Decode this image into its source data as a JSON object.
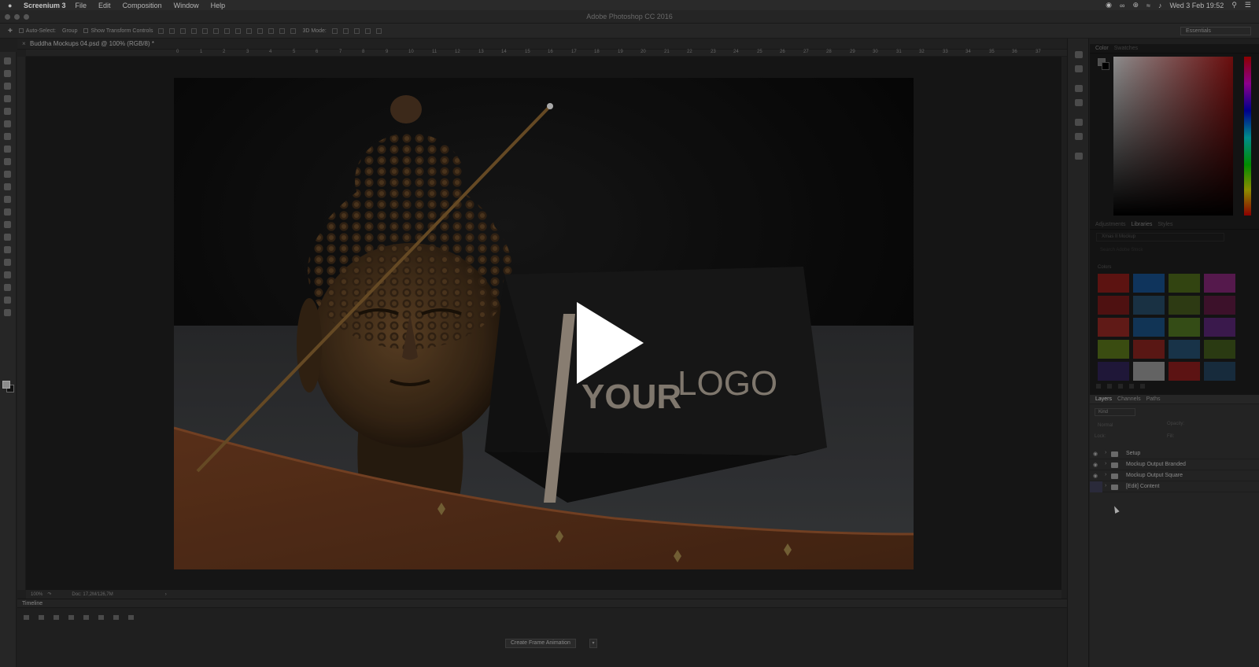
{
  "menubar": {
    "app_name": "Screenium 3",
    "items": [
      "File",
      "Edit",
      "Composition",
      "Window",
      "Help"
    ],
    "datetime": "Wed 3 Feb  19:52"
  },
  "window": {
    "title": "Adobe Photoshop CC 2016"
  },
  "options_bar": {
    "auto_select": "Auto-Select:",
    "group_select": "Group",
    "show_transform": "Show Transform Controls",
    "mode_3d": "3D Mode:",
    "workspace": "Essentials"
  },
  "document": {
    "tab_title": "Buddha Mockups 04.psd @ 100% (RGB/8) *",
    "ruler_numbers": [
      "0",
      "1",
      "2",
      "3",
      "4",
      "5",
      "6",
      "7",
      "8",
      "9",
      "10",
      "11",
      "12",
      "13",
      "14",
      "15",
      "16",
      "17",
      "18",
      "19",
      "20",
      "21",
      "22",
      "23",
      "24",
      "25",
      "26",
      "27",
      "28",
      "29",
      "30",
      "31",
      "32",
      "33",
      "34",
      "35",
      "36",
      "37"
    ],
    "zoom": "100%",
    "doc_info": "Doc: 17,2M/126,7M",
    "photo_logo_bold": "YOUR",
    "photo_logo_light": "LOGO"
  },
  "timeline": {
    "title": "Timeline",
    "create_button": "Create Frame Animation"
  },
  "color_panel": {
    "tabs": [
      "Color",
      "Swatches"
    ]
  },
  "libraries_panel": {
    "tabs": [
      "Adjustments",
      "Libraries",
      "Styles"
    ],
    "library": "Xmas II Mockup",
    "search_placeholder": "Search Adobe Stock",
    "colors_label": "Colors",
    "swatches": [
      "#a8231f",
      "#1d5fa8",
      "#5b7c1f",
      "#9c2f8a",
      "#8e1f1f",
      "#2f5a7a",
      "#526b24",
      "#6e1f4e",
      "#b0302a",
      "#1f5f9c",
      "#5f8a28",
      "#6a2f8a",
      "#6b8a1f",
      "#a32a25",
      "#2c5d83",
      "#4e6a22",
      "#3a2a66",
      "#b5b5b5",
      "#a82424",
      "#2a4f6e"
    ]
  },
  "layers_panel": {
    "tabs": [
      "Layers",
      "Channels",
      "Paths"
    ],
    "filter": "Kind",
    "blend_mode": "Normal",
    "opacity_label": "Opacity:",
    "lock_label": "Lock:",
    "fill_label": "Fill:",
    "layers": [
      {
        "name": "Setup",
        "visible": true
      },
      {
        "name": "Mockup Output Branded",
        "visible": true
      },
      {
        "name": "Mockup Output Square",
        "visible": true
      },
      {
        "name": "[Edit] Content",
        "visible": false
      }
    ]
  }
}
